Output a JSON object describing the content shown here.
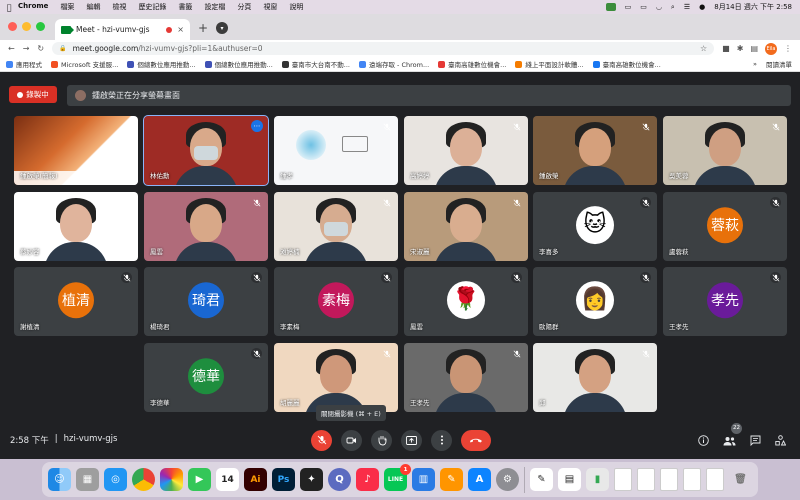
{
  "menubar": {
    "app": "Chrome",
    "menus": [
      "檔案",
      "編輯",
      "檢視",
      "歷史記錄",
      "書籤",
      "設定檔",
      "分頁",
      "視窗",
      "說明"
    ],
    "clock": "8月14日 週六 下午 2:58"
  },
  "tab": {
    "title": "Meet - hzi-vumv-gjs",
    "close": "×",
    "new_tab": "+"
  },
  "address": {
    "host": "meet.google.com",
    "path": "/hzi-vumv-gjs?pli=1&authuser=0",
    "profile": "Eila"
  },
  "bookmarks": {
    "items": [
      {
        "label": "應用程式",
        "color": "#4285f4"
      },
      {
        "label": "Microsoft 支援服...",
        "color": "#f25022"
      },
      {
        "label": "個總數位應用推動...",
        "color": "#3f51b5"
      },
      {
        "label": "個總數位應用推動...",
        "color": "#3f51b5"
      },
      {
        "label": "臺南市大台南不動...",
        "color": "#333333"
      },
      {
        "label": "遠端存取 - Chrom...",
        "color": "#4285f4"
      },
      {
        "label": "臺南高雄數位機會...",
        "color": "#e53935"
      },
      {
        "label": "綫上平面設計軟體...",
        "color": "#f57c00"
      },
      {
        "label": "臺南高雄數位機會...",
        "color": "#1877f2"
      }
    ],
    "more": "»",
    "reading_list": "閱讀清單"
  },
  "meet": {
    "recording_label": "錄製中",
    "presenting_text": "鍾啟榮正在分享螢幕畫面",
    "participants": [
      {
        "name": "鍾啟榮(簡報)",
        "type": "screen"
      },
      {
        "name": "林佑勳",
        "type": "video",
        "skin": "#d9a98a",
        "bg": "#9e2b25",
        "active": true
      },
      {
        "name": "鍾孝",
        "type": "screen2"
      },
      {
        "name": "高婷婷",
        "type": "video",
        "skin": "#dcb097",
        "bg": "#e8e4e0"
      },
      {
        "name": "鍾啟榮",
        "type": "video",
        "skin": "#d5a07c",
        "bg": "#7a5b3d"
      },
      {
        "name": "吳美蓉",
        "type": "video",
        "skin": "#cf9f82",
        "bg": "#c8c0b0"
      },
      {
        "name": "蔡妙容",
        "type": "video",
        "skin": "#e0b49c",
        "bg": "#ffffff"
      },
      {
        "name": "鳳雲",
        "type": "video",
        "skin": "#d8a888",
        "bg": "#b06b7a"
      },
      {
        "name": "滩婷楠",
        "type": "video",
        "skin": "#d6ac90",
        "bg": "#e8e2da"
      },
      {
        "name": "宋淑麗",
        "type": "video",
        "skin": "#d9ad8f",
        "bg": "#b89b7b"
      },
      {
        "name": "李喜多",
        "type": "photo",
        "emoji": "🐱"
      },
      {
        "name": "盧蓉萩",
        "type": "avatar",
        "initials": "蓉萩",
        "color": "#e8710a"
      },
      {
        "name": "謝植清",
        "type": "avatar",
        "initials": "植清",
        "color": "#e8710a"
      },
      {
        "name": "楊琦君",
        "type": "avatar",
        "initials": "琦君",
        "color": "#1967d2"
      },
      {
        "name": "李素梅",
        "type": "avatar",
        "initials": "素梅",
        "color": "#c2185b"
      },
      {
        "name": "鳳雲",
        "type": "photo",
        "emoji": "🌹"
      },
      {
        "name": "歐陽群",
        "type": "photo",
        "emoji": "👩"
      },
      {
        "name": "王孝先",
        "type": "avatar",
        "initials": "孝先",
        "color": "#6a1b9a"
      },
      {
        "name": "李德華",
        "type": "avatar",
        "initials": "德華",
        "color": "#1e8e3e"
      },
      {
        "name": "胡麗麗",
        "type": "video",
        "skin": "#cf987a",
        "bg": "#f0d8c0"
      },
      {
        "name": "王孝先",
        "type": "video",
        "skin": "#c99575",
        "bg": "#6a6a6a"
      },
      {
        "name": "邱",
        "type": "video",
        "skin": "#d4a182",
        "bg": "#e8e8e6"
      }
    ],
    "control": {
      "time": "2:58 下午",
      "separator": "|",
      "code": "hzi-vumv-gjs",
      "tooltip": "關閉攝影機 (⌘ + E)",
      "people_count": "22"
    }
  },
  "dock": {
    "calendar_day": "14",
    "line_badge": "1"
  }
}
